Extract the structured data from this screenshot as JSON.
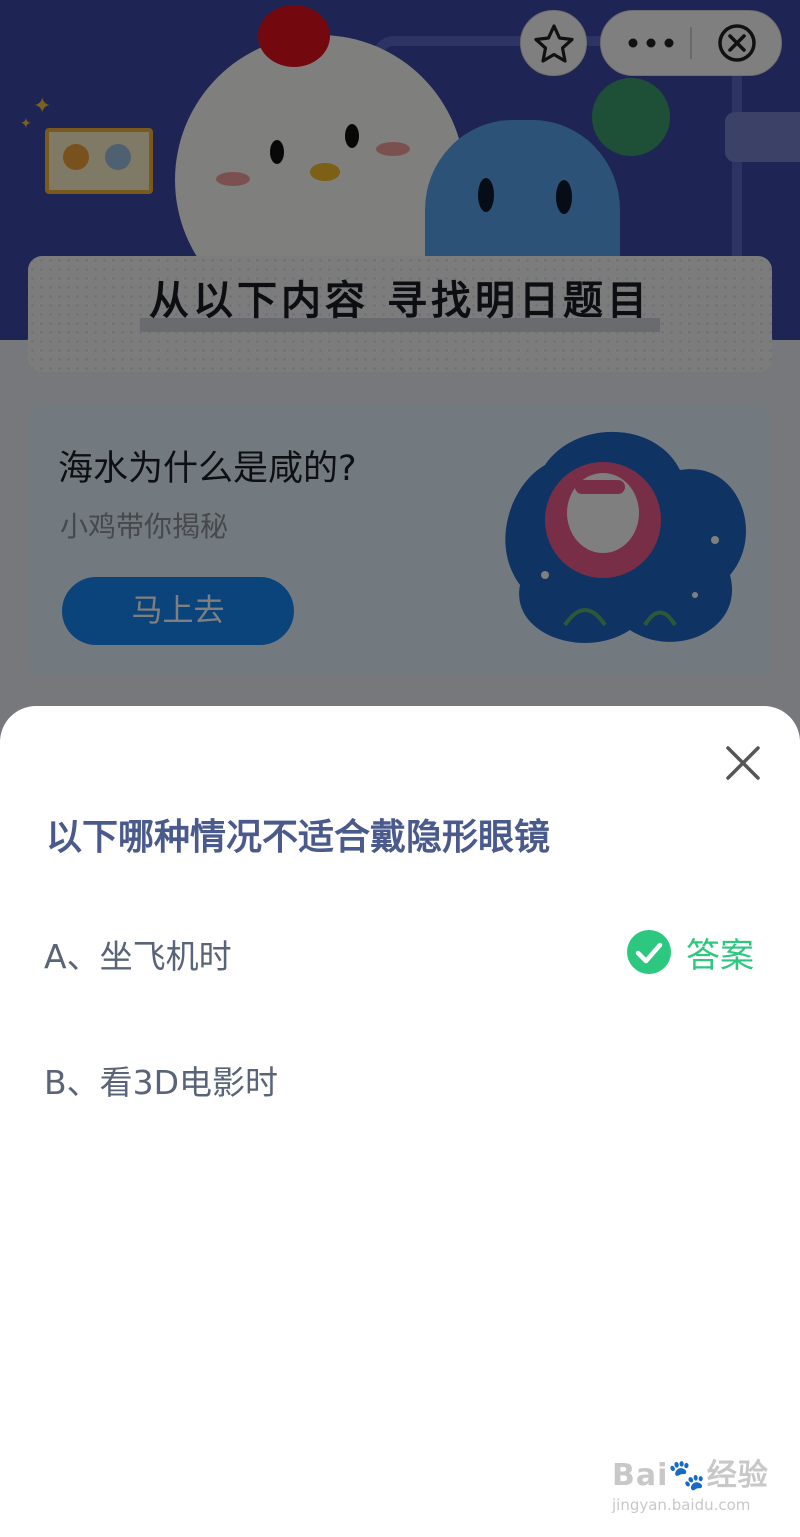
{
  "topbar": {
    "star_icon": "star-icon",
    "more_icon": "more-icon",
    "close_icon": "close-circle-icon"
  },
  "banner": {
    "title": "从以下内容 寻找明日题目"
  },
  "promo": {
    "title": "海水为什么是咸的?",
    "subtitle": "小鸡带你揭秘",
    "button_label": "马上去"
  },
  "sheet": {
    "question": "以下哪种情况不适合戴隐形眼镜",
    "options": [
      {
        "label": "A、坐飞机时",
        "is_answer": true
      },
      {
        "label": "B、看3D电影时",
        "is_answer": false
      }
    ],
    "answer_label": "答案",
    "answer_color": "#2dc87f"
  },
  "watermark": {
    "main": "Bai",
    "main_cn": "经验",
    "sub": "jingyan.baidu.com"
  }
}
